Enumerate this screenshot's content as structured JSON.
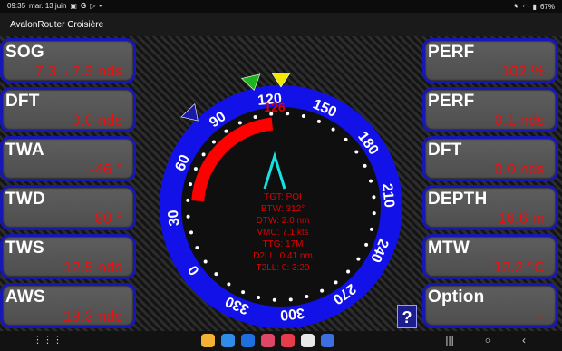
{
  "status": {
    "time": "09:35",
    "date": "mar. 13 juin",
    "left_icons": [
      "gallery-icon",
      "google-icon",
      "play-icon",
      "dot-icon"
    ],
    "battery": "67%"
  },
  "app": {
    "title": "AvalonRouter Croisière"
  },
  "left_tiles": [
    {
      "label": "SOG",
      "value": "7.3→7.3 nds"
    },
    {
      "label": "DFT",
      "value": "0.0 nds"
    },
    {
      "label": "TWA",
      "value": "-46 °"
    },
    {
      "label": "TWD",
      "value": "80 °"
    },
    {
      "label": "TWS",
      "value": "12.5 nds"
    },
    {
      "label": "AWS",
      "value": "18.3 nds"
    }
  ],
  "right_tiles": [
    {
      "label": "PERF",
      "value": "102 %"
    },
    {
      "label": "PERF",
      "value": "0.1 nds"
    },
    {
      "label": "DFT",
      "value": "0.0 nds"
    },
    {
      "label": "DEPTH",
      "value": "16.6 m"
    },
    {
      "label": "MTW",
      "value": "12.2 °C"
    },
    {
      "label": "Option",
      "value": "--"
    }
  ],
  "compass": {
    "heading": 126,
    "heading_label": "126",
    "ring_labels": [
      {
        "deg": 0,
        "text": "0"
      },
      {
        "deg": 30,
        "text": "30"
      },
      {
        "deg": 60,
        "text": "60"
      },
      {
        "deg": 90,
        "text": "90"
      },
      {
        "deg": 120,
        "text": "120"
      },
      {
        "deg": 150,
        "text": "150"
      },
      {
        "deg": 180,
        "text": "180"
      },
      {
        "deg": 210,
        "text": "210"
      },
      {
        "deg": 240,
        "text": "240"
      },
      {
        "deg": 270,
        "text": "270"
      },
      {
        "deg": 300,
        "text": "300"
      },
      {
        "deg": 330,
        "text": "330"
      }
    ],
    "wind_arc": {
      "from_deg": 40,
      "to_deg": 120
    },
    "markers": [
      {
        "deg": 126,
        "color": "#f2ea00",
        "name": "heading-marker"
      },
      {
        "deg": 113,
        "color": "#1db51d",
        "name": "cog-marker"
      },
      {
        "deg": 82,
        "color": "#1a1aa8",
        "name": "twd-marker"
      }
    ],
    "colors": {
      "ring": "#1111e8",
      "arc": "#ff0000",
      "wind_arrow": "#17e0e0",
      "text": "#e00000"
    },
    "info_lines": [
      "TGT: POI",
      "BTW: 312°",
      "DTW: 2.0 nm",
      "VMC: 7.1 kts",
      "TTG: 17M",
      "D2LL: 0.41 nm",
      "T2LL: 0: 3:20"
    ]
  },
  "help_label": "?",
  "dock": [
    {
      "name": "files-app",
      "color": "#f2b233"
    },
    {
      "name": "calendar-app",
      "color": "#2f8ce8"
    },
    {
      "name": "messages-app",
      "color": "#1f6fe0"
    },
    {
      "name": "gallery-app",
      "color": "#e04668"
    },
    {
      "name": "camera-app",
      "color": "#e83c4c"
    },
    {
      "name": "play-store-app",
      "color": "#e8e8e8"
    },
    {
      "name": "settings-app",
      "color": "#3d6fe0"
    }
  ]
}
